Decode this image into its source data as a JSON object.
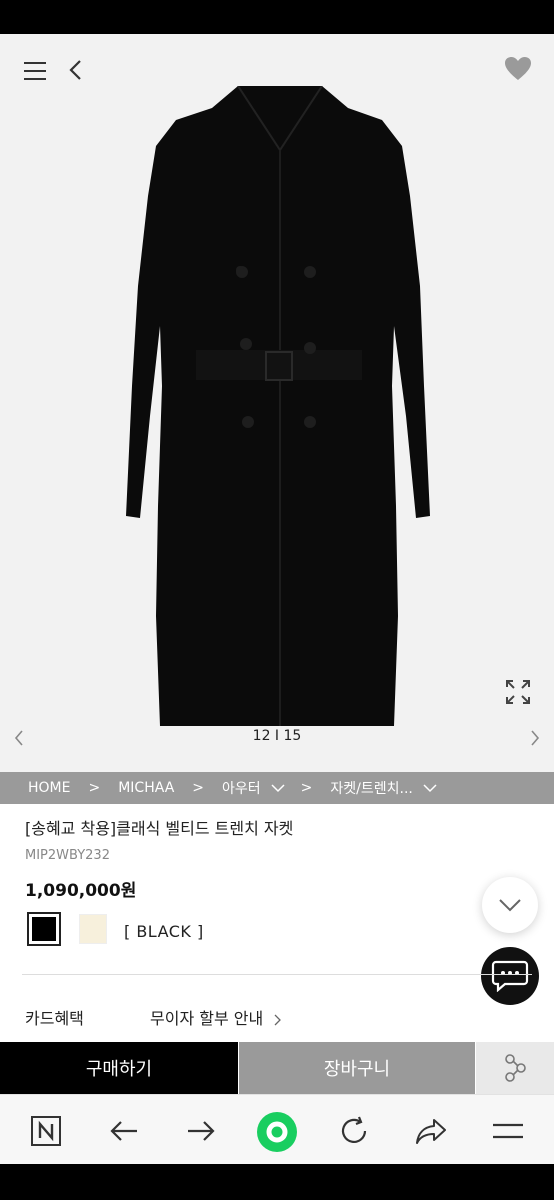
{
  "hero": {
    "counter": "12 I 15"
  },
  "breadcrumb": {
    "home": "HOME",
    "sep": ">",
    "brand": "MICHAA",
    "category": "아우터",
    "subcategory": "자켓/트렌치..."
  },
  "product": {
    "title": "[송혜교 착용]클래식 벨티드 트렌치 자켓",
    "code": "MIP2WBY232",
    "price": "1,090,000원",
    "selected_color": "[ BLACK ]",
    "swatch_colors": [
      "#000000",
      "#f7f0dc"
    ]
  },
  "card": {
    "label": "카드혜택",
    "link": "무이자 할부 안내"
  },
  "actions": {
    "buy": "구매하기",
    "cart": "장바구니"
  },
  "colors": {
    "accent_green": "#19ce60",
    "breadcrumb_bg": "#9a9a9a"
  }
}
